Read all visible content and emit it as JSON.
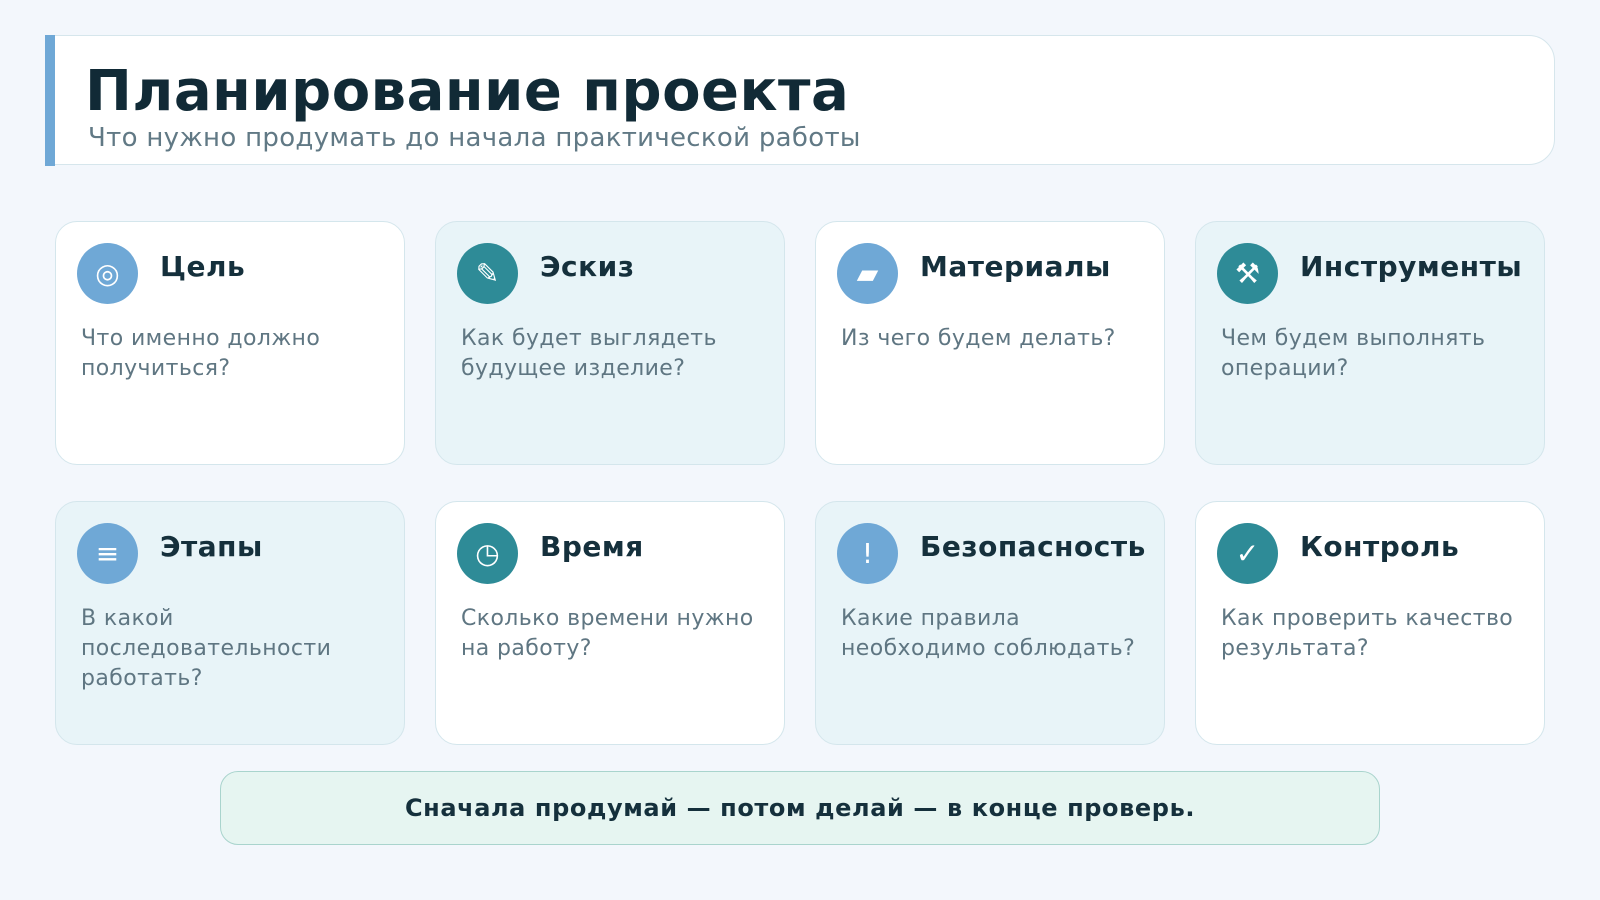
{
  "header": {
    "title": "Планирование проекта",
    "subtitle": "Что нужно продумать до начала практической работы"
  },
  "colors": {
    "accent_blue": "#6fa8d6",
    "accent_teal": "#2e8b97",
    "card_tint": "#e8f4f8",
    "footer_bg": "#e6f5f1"
  },
  "cards": [
    {
      "title": "Цель",
      "text": "Что именно должно получиться?",
      "icon": "target-icon",
      "glyph": "◎",
      "color": "#6fa8d6",
      "tinted": false
    },
    {
      "title": "Эскиз",
      "text": "Как будет выглядеть будущее изделие?",
      "icon": "pencil-icon",
      "glyph": "✎",
      "color": "#2e8b97",
      "tinted": true
    },
    {
      "title": "Материалы",
      "text": "Из чего будем делать?",
      "icon": "material-icon",
      "glyph": "▰",
      "color": "#6fa8d6",
      "tinted": false
    },
    {
      "title": "Инструменты",
      "text": "Чем будем выполнять операции?",
      "icon": "tools-icon",
      "glyph": "⚒",
      "color": "#2e8b97",
      "tinted": true
    },
    {
      "title": "Этапы",
      "text": "В какой последовательности работать?",
      "icon": "list-icon",
      "glyph": "≡",
      "color": "#6fa8d6",
      "tinted": true
    },
    {
      "title": "Время",
      "text": "Сколько времени нужно на работу?",
      "icon": "clock-icon",
      "glyph": "◷",
      "color": "#2e8b97",
      "tinted": false
    },
    {
      "title": "Безопасность",
      "text": "Какие правила необходимо соблюдать?",
      "icon": "warning-icon",
      "glyph": "!",
      "color": "#6fa8d6",
      "tinted": true
    },
    {
      "title": "Контроль",
      "text": "Как проверить качество результата?",
      "icon": "check-icon",
      "glyph": "✓",
      "color": "#2e8b97",
      "tinted": false
    }
  ],
  "footer": {
    "text": "Сначала продумай — потом делай — в конце проверь."
  }
}
